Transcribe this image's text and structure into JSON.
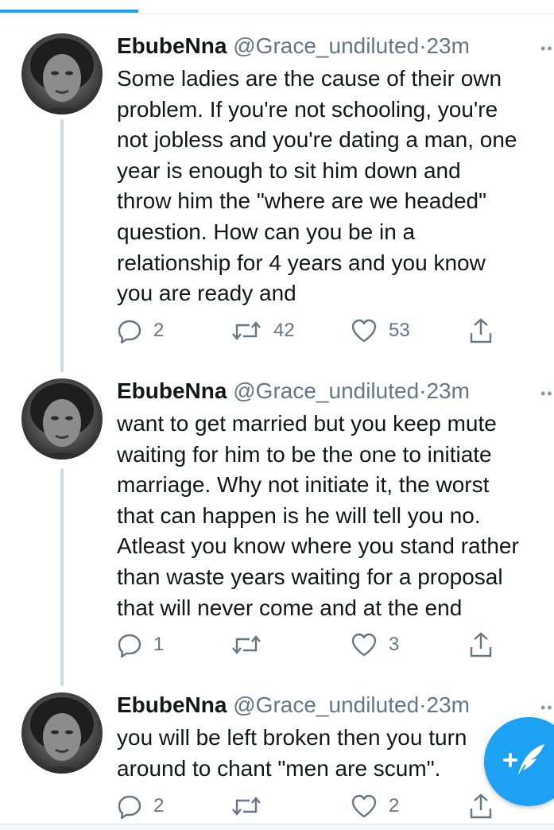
{
  "tweets": [
    {
      "name": "EbubeNna",
      "handle": "@Grace_undiluted",
      "separator": "·",
      "time": "23m",
      "text": "Some ladies are the cause of their own\nproblem. If you're not schooling, you're\nnot jobless and you're dating a man, one\nyear is enough to sit him down and\nthrow him the \"where are we headed\"\nquestion. How can you be in a\nrelationship for 4 years and you know\nyou are ready and",
      "replies": "2",
      "retweets": "42",
      "likes": "53"
    },
    {
      "name": "EbubeNna",
      "handle": "@Grace_undiluted",
      "separator": "·",
      "time": "23m",
      "text": "want to get married but you keep mute\nwaiting for him to be the one to initiate\nmarriage. Why not initiate it, the worst\nthat can happen is he will tell you no.\nAtleast you know where you stand rather\nthan waste years waiting for a proposal\nthat will never come and at the end",
      "replies": "1",
      "retweets": "",
      "likes": "3"
    },
    {
      "name": "EbubeNna",
      "handle": "@Grace_undiluted",
      "separator": "·",
      "time": "23m",
      "text": "you will be left broken then you turn\naround to chant \"men are scum\".",
      "replies": "2",
      "retweets": "",
      "likes": "2"
    }
  ],
  "icons": {
    "reply": "reply-icon",
    "retweet": "retweet-icon",
    "like": "heart-icon",
    "share": "share-icon",
    "more": "more-icon",
    "compose": "compose-tweet-icon"
  },
  "colors": {
    "accent": "#1da1f2",
    "text": "#14171a",
    "secondary": "#657786",
    "thread_line": "#cfd9de"
  }
}
